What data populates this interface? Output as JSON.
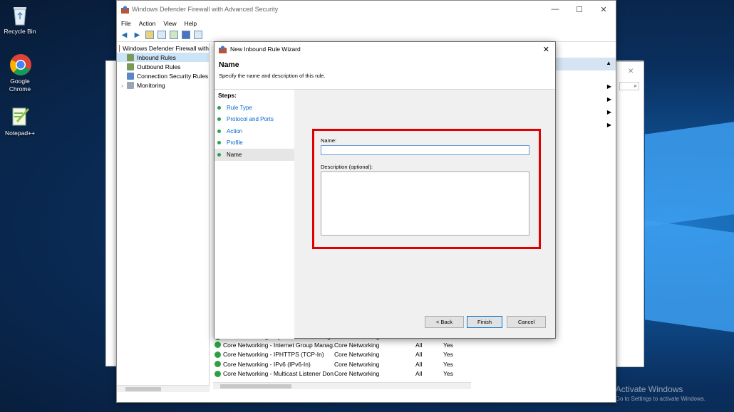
{
  "desktop": {
    "icons": [
      {
        "label": "Recycle Bin",
        "icon": "recycle-bin-icon"
      },
      {
        "label": "Google Chrome",
        "icon": "chrome-icon"
      },
      {
        "label": "Notepad++",
        "icon": "notepadpp-icon"
      }
    ],
    "watermark_line1": "Activate Windows",
    "watermark_line2": "Go to Settings to activate Windows."
  },
  "main_window": {
    "title": "Windows Defender Firewall with Advanced Security",
    "controls": {
      "minimize": "—",
      "maximize": "☐",
      "close": "✕"
    },
    "menu": [
      "File",
      "Action",
      "View",
      "Help"
    ],
    "tree": {
      "root": "Windows Defender Firewall with",
      "items": [
        "Inbound Rules",
        "Outbound Rules",
        "Connection Security Rules",
        "Monitoring"
      ],
      "selected": "Inbound Rules"
    },
    "rules": [
      {
        "name": "Core Networking - Dynamic Host Configur...",
        "group": "Core Networking",
        "profile": "All",
        "enabled": "Yes"
      },
      {
        "name": "Core Networking - Internet Group Manag...",
        "group": "Core Networking",
        "profile": "All",
        "enabled": "Yes"
      },
      {
        "name": "Core Networking - IPHTTPS (TCP-In)",
        "group": "Core Networking",
        "profile": "All",
        "enabled": "Yes"
      },
      {
        "name": "Core Networking - IPv6 (IPv6-In)",
        "group": "Core Networking",
        "profile": "All",
        "enabled": "Yes"
      },
      {
        "name": "Core Networking - Multicast Listener Don...",
        "group": "Core Networking",
        "profile": "All",
        "enabled": "Yes"
      }
    ]
  },
  "wizard": {
    "title": "New Inbound Rule Wizard",
    "close_glyph": "✕",
    "heading": "Name",
    "subheading": "Specify the name and description of this rule.",
    "steps_label": "Steps:",
    "steps": [
      "Rule Type",
      "Protocol and Ports",
      "Action",
      "Profile",
      "Name"
    ],
    "current_step": "Name",
    "name_label": "Name:",
    "name_value": "",
    "description_label": "Description (optional):",
    "description_value": "",
    "buttons": {
      "back": "< Back",
      "finish": "Finish",
      "cancel": "Cancel"
    },
    "highlight_color": "#e00000"
  }
}
